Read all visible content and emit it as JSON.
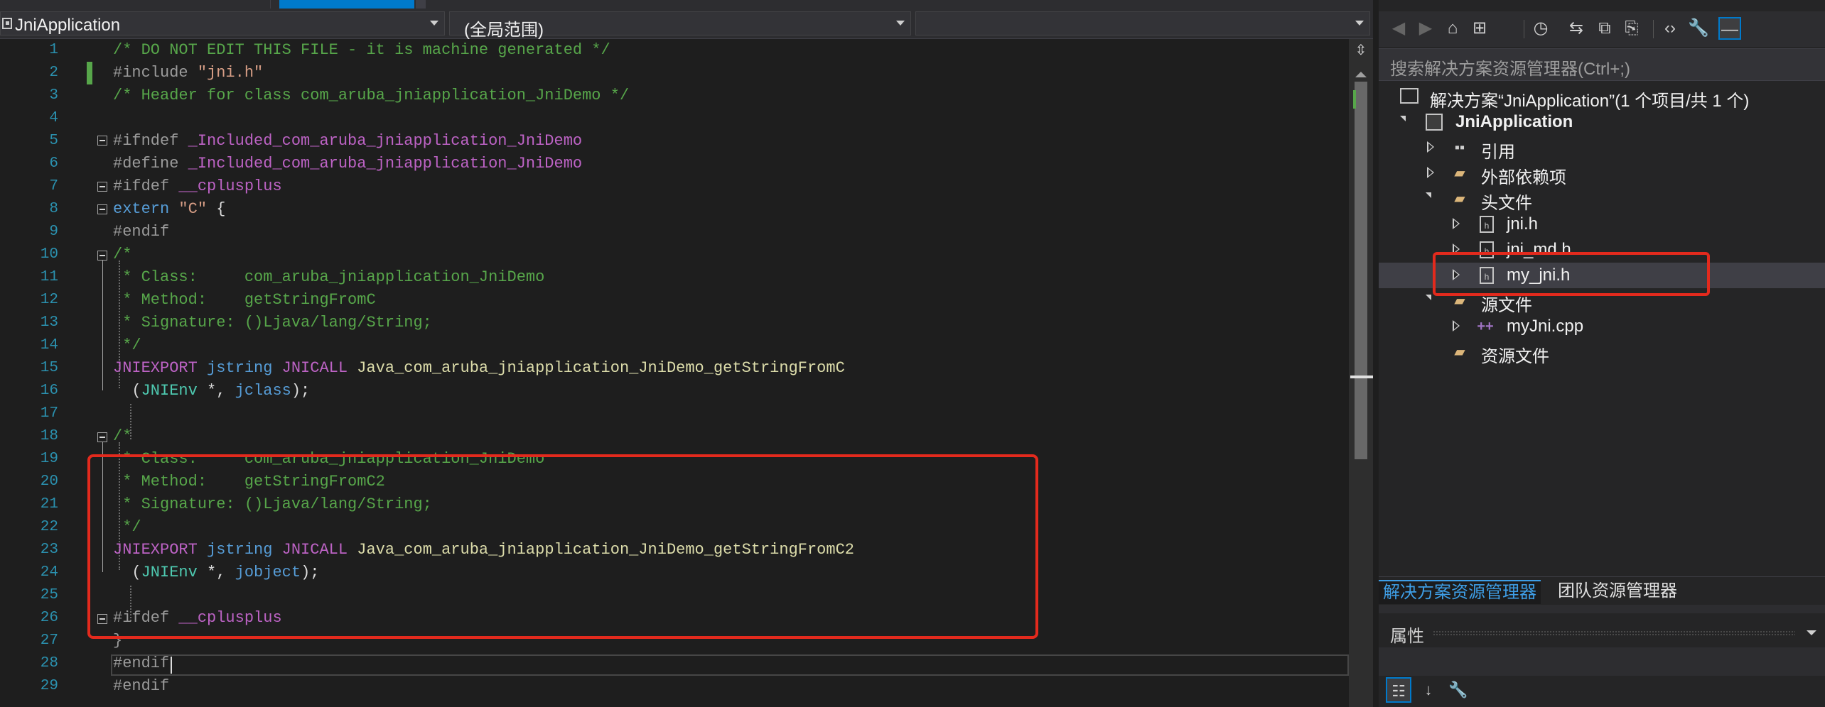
{
  "navbar": {
    "project": "JniApplication",
    "scope": "(全局范围)",
    "member": ""
  },
  "editor": {
    "line_numbers": [
      "1",
      "2",
      "3",
      "4",
      "5",
      "6",
      "7",
      "8",
      "9",
      "10",
      "11",
      "12",
      "13",
      "14",
      "15",
      "16",
      "17",
      "18",
      "19",
      "20",
      "21",
      "22",
      "23",
      "24",
      "25",
      "26",
      "27",
      "28",
      "29"
    ],
    "lines": {
      "l1": "/* DO NOT EDIT THIS FILE - it is machine generated */",
      "l2_kw": "#include ",
      "l2_str": "\"jni.h\"",
      "l3": "/* Header for class com_aruba_jniapplication_JniDemo */",
      "l5_kw": "#ifndef ",
      "l5_id": "_Included_com_aruba_jniapplication_JniDemo",
      "l6_kw": "#define ",
      "l6_id": "_Included_com_aruba_jniapplication_JniDemo",
      "l7_kw": "#ifdef ",
      "l7_id": "__cplusplus",
      "l8_kw": "extern ",
      "l8_str": "\"C\"",
      "l8_rest": " {",
      "l9": "#endif",
      "l10": "/*",
      "l11": " * Class:     com_aruba_jniapplication_JniDemo",
      "l12": " * Method:    getStringFromC",
      "l13": " * Signature: ()Ljava/lang/String;",
      "l14": " */",
      "l15_a": "JNIEXPORT ",
      "l15_b": "jstring ",
      "l15_c": "JNICALL ",
      "l15_d": "Java_com_aruba_jniapplication_JniDemo_getStringFromC",
      "l16_a": "  (",
      "l16_b": "JNIEnv",
      "l16_c": " *, ",
      "l16_d": "jclass",
      "l16_e": ");",
      "l18": "/*",
      "l19": " * Class:     com_aruba_jniapplication_JniDemo",
      "l20": " * Method:    getStringFromC2",
      "l21": " * Signature: ()Ljava/lang/String;",
      "l22": " */",
      "l23_a": "JNIEXPORT ",
      "l23_b": "jstring ",
      "l23_c": "JNICALL ",
      "l23_d": "Java_com_aruba_jniapplication_JniDemo_getStringFromC2",
      "l24_a": "  (",
      "l24_b": "JNIEnv",
      "l24_c": " *, ",
      "l24_d": "jobject",
      "l24_e": ");",
      "l26_kw": "#ifdef ",
      "l26_id": "__cplusplus",
      "l27": "}",
      "l28": "#endif",
      "l29": "#endif"
    }
  },
  "solution_explorer": {
    "search_placeholder": "搜索解决方案资源管理器(Ctrl+;)",
    "solution": "解决方案“JniApplication”(1 个项目/共 1 个)",
    "project": "JniApplication",
    "references": "引用",
    "external_deps": "外部依赖项",
    "header_files": "头文件",
    "jni_h": "jni.h",
    "jni_md_h": "jni_md.h",
    "my_jni_h": "my_jni.h",
    "source_files": "源文件",
    "myjni_cpp": "myJni.cpp",
    "resource_files": "资源文件",
    "tab_solution": "解决方案资源管理器",
    "tab_team": "团队资源管理器"
  },
  "properties": {
    "title": "属性"
  },
  "colors": {
    "accent": "#007acc",
    "highlight_box": "#e32a1d",
    "comment": "#57a64a",
    "keyword": "#569cd6"
  }
}
